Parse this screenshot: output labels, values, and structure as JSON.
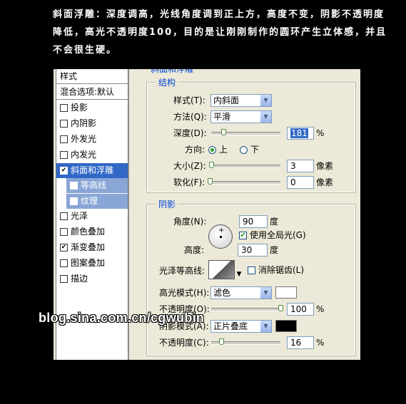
{
  "caption": {
    "line1": "斜面浮雕：深度调高，光线角度调到正上方，高度不变，阴影不透明度",
    "line2": "降低，高光不透明度100，目的是让刚刚制作的圆环产生立体感，并且",
    "line3": "不会很生硬。"
  },
  "styles_panel": {
    "header": "样式",
    "blend_options": "混合选项:默认",
    "items": [
      {
        "label": "投影",
        "checked": false
      },
      {
        "label": "内阴影",
        "checked": false
      },
      {
        "label": "外发光",
        "checked": false
      },
      {
        "label": "内发光",
        "checked": false
      },
      {
        "label": "斜面和浮雕",
        "checked": true
      },
      {
        "label": "等高线",
        "checked": false
      },
      {
        "label": "纹理",
        "checked": false
      },
      {
        "label": "光泽",
        "checked": false
      },
      {
        "label": "颜色叠加",
        "checked": false
      },
      {
        "label": "渐变叠加",
        "checked": true
      },
      {
        "label": "图案叠加",
        "checked": false
      },
      {
        "label": "描边",
        "checked": false
      }
    ]
  },
  "panel_title": "斜面和浮雕",
  "structure": {
    "title": "结构",
    "style_label": "样式(T):",
    "style_value": "内斜面",
    "technique_label": "方法(Q):",
    "technique_value": "平滑",
    "depth_label": "深度(D):",
    "depth_value": "181",
    "depth_unit": "%",
    "direction_label": "方向:",
    "direction_up": "上",
    "direction_down": "下",
    "size_label": "大小(Z):",
    "size_value": "3",
    "size_unit": "像素",
    "soften_label": "软化(F):",
    "soften_value": "0",
    "soften_unit": "像素"
  },
  "shading": {
    "title": "阴影",
    "angle_label": "角度(N):",
    "angle_value": "90",
    "angle_unit": "度",
    "global_light_label": "使用全局光(G)",
    "altitude_label": "高度:",
    "altitude_value": "30",
    "altitude_unit": "度",
    "gloss_label": "光泽等高线:",
    "antialias_label": "消除锯齿(L)",
    "highlight_mode_label": "高光模式(H):",
    "highlight_mode_value": "滤色",
    "highlight_color": "#ffffff",
    "highlight_opacity_label": "不透明度(O):",
    "highlight_opacity_value": "100",
    "highlight_opacity_unit": "%",
    "shadow_mode_label": "阴影模式(A):",
    "shadow_mode_value": "正片叠底",
    "shadow_color": "#000000",
    "shadow_opacity_label": "不透明度(C):",
    "shadow_opacity_value": "16",
    "shadow_opacity_unit": "%"
  },
  "watermark": "blog.sina.com.cn/cgwubin"
}
